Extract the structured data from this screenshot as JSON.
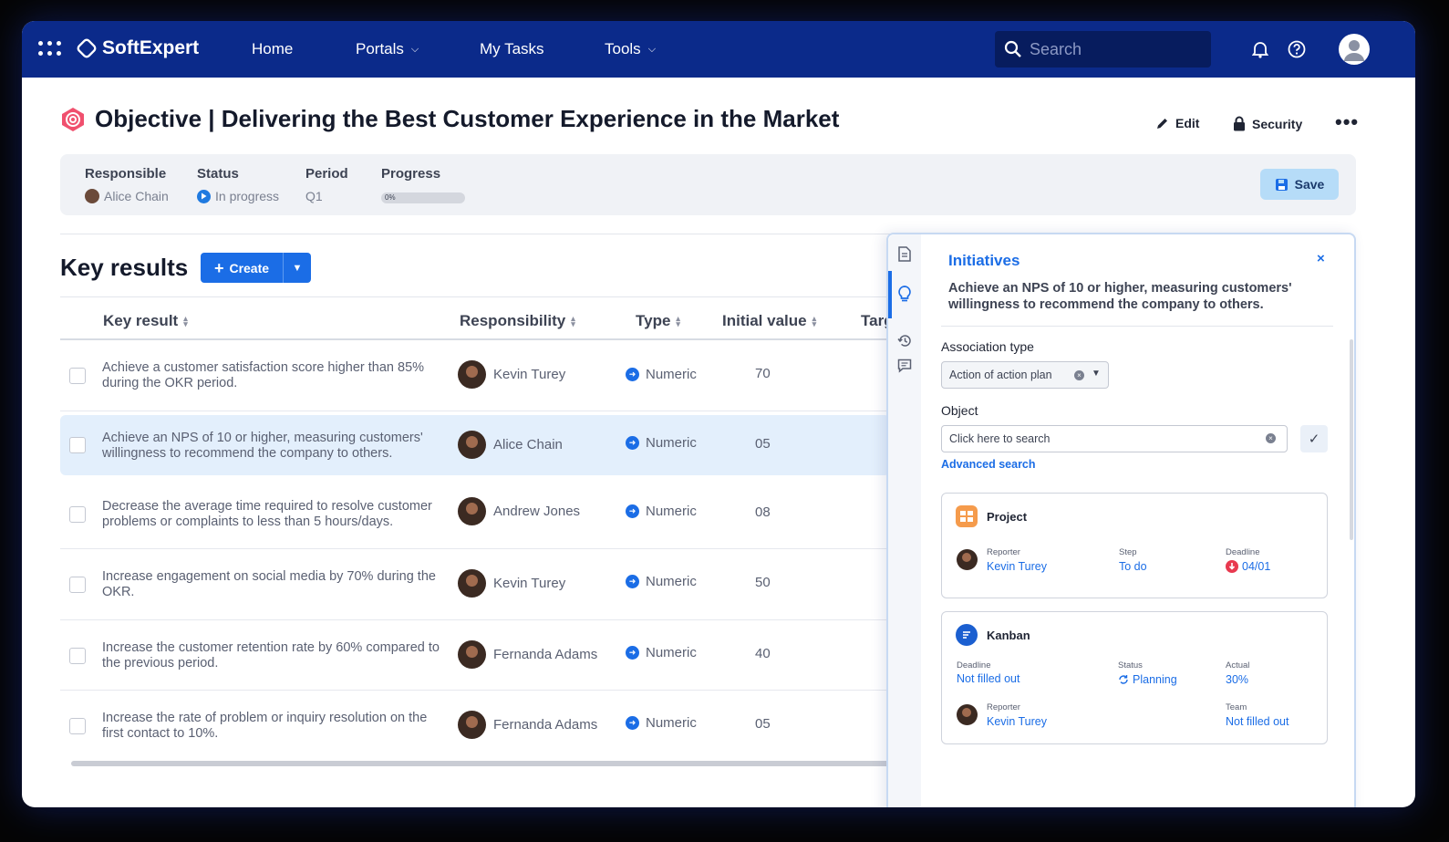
{
  "topbar": {
    "brand": "SoftExpert",
    "nav": [
      {
        "label": "Home",
        "has_dropdown": false
      },
      {
        "label": "Portals",
        "has_dropdown": true
      },
      {
        "label": "My Tasks",
        "has_dropdown": false
      },
      {
        "label": "Tools",
        "has_dropdown": true
      }
    ],
    "search_placeholder": "Search"
  },
  "header": {
    "title": "Objective | Delivering the Best Customer Experience in the Market",
    "edit_label": "Edit",
    "security_label": "Security",
    "more_label": "•••"
  },
  "info": {
    "responsible_label": "Responsible",
    "responsible_value": "Alice Chain",
    "status_label": "Status",
    "status_value": "In progress",
    "period_label": "Period",
    "period_value": "Q1",
    "progress_label": "Progress",
    "progress_text": "0%",
    "progress_fraction": 0.0,
    "save_label": "Save"
  },
  "key_results": {
    "title": "Key results",
    "create_label": "Create",
    "columns": [
      "Key result",
      "Responsibility",
      "Type",
      "Initial value",
      "Targ"
    ],
    "rows": [
      {
        "text": "Achieve a customer satisfaction score higher than 85% during the OKR period.",
        "person": "Kevin Turey",
        "type": "Numeric",
        "initial": "70",
        "selected": false
      },
      {
        "text": "Achieve an NPS of 10 or higher, measuring customers' willingness to recommend the company to others.",
        "person": "Alice Chain",
        "type": "Numeric",
        "initial": "05",
        "selected": true
      },
      {
        "text": "Decrease the average time required to resolve customer problems or complaints to less than 5 hours/days.",
        "person": "Andrew Jones",
        "type": "Numeric",
        "initial": "08",
        "selected": false
      },
      {
        "text": "Increase engagement on social media by 70% during the OKR.",
        "person": "Kevin Turey",
        "type": "Numeric",
        "initial": "50",
        "selected": false
      },
      {
        "text": "Increase the customer retention rate by 60% compared to the previous period.",
        "person": "Fernanda Adams",
        "type": "Numeric",
        "initial": "40",
        "selected": false
      },
      {
        "text": "Increase the rate of problem or inquiry resolution on the first contact to 10%.",
        "person": "Fernanda Adams",
        "type": "Numeric",
        "initial": "05",
        "selected": false
      }
    ]
  },
  "panel": {
    "title": "Initiatives",
    "close": "×",
    "description": "Achieve an NPS of 10 or higher, measuring customers' willingness to recommend the company to others.",
    "association_label": "Association type",
    "association_value": "Action of action plan",
    "object_label": "Object",
    "object_placeholder": "Click here to search",
    "advanced_search": "Advanced search",
    "cards": [
      {
        "title": "Project",
        "fields": [
          {
            "label": "Reporter",
            "value": "Kevin Turey"
          },
          {
            "label": "Step",
            "value": "To do"
          },
          {
            "label": "Deadline",
            "value": "04/01"
          }
        ]
      },
      {
        "title": "Kanban",
        "fields": [
          {
            "label": "Deadline",
            "value": "Not filled out"
          },
          {
            "label": "Status",
            "value": "Planning"
          },
          {
            "label": "Actual",
            "value": "30%"
          },
          {
            "label": "Reporter",
            "value": "Kevin Turey"
          },
          {
            "label": "Team",
            "value": "Not filled out"
          }
        ]
      }
    ]
  },
  "colors": {
    "topbar": "#0b2a8a",
    "accent": "#1b6de6",
    "selected_row": "#e3effc",
    "save_button": "#b6dcf8",
    "deadline_alert": "#e8394f"
  }
}
